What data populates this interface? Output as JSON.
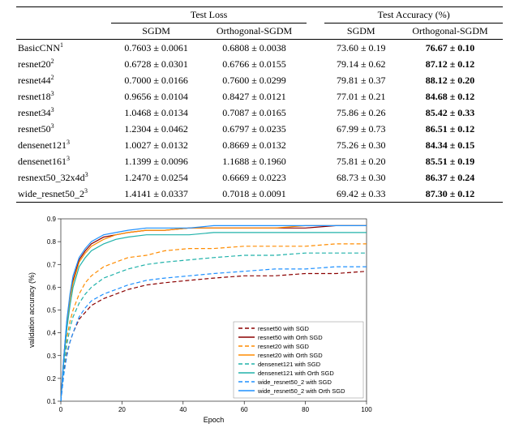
{
  "table": {
    "group_headers": [
      "Test Loss",
      "Test Accuracy (%)"
    ],
    "col_headers": [
      "SGDM",
      "Orthogonal-SGDM",
      "SGDM",
      "Orthogonal-SGDM"
    ],
    "rows": [
      {
        "model": "BasicCNN",
        "sup": "1",
        "loss_sgdm": "0.7603 ± 0.0061",
        "loss_orth": "0.6808 ± 0.0038",
        "acc_sgdm": "73.60 ± 0.19",
        "acc_orth": "76.67 ± 0.10",
        "bold": "orth"
      },
      {
        "model": "resnet20",
        "sup": "2",
        "loss_sgdm": "0.6728 ± 0.0301",
        "loss_orth": "0.6766 ± 0.0155",
        "acc_sgdm": "79.14 ± 0.62",
        "acc_orth": "87.12 ± 0.12",
        "bold": "orth"
      },
      {
        "model": "resnet44",
        "sup": "2",
        "loss_sgdm": "0.7000 ± 0.0166",
        "loss_orth": "0.7600 ± 0.0299",
        "acc_sgdm": "79.81 ± 0.37",
        "acc_orth": "88.12 ± 0.20",
        "bold": "orth"
      },
      {
        "model": "resnet18",
        "sup": "3",
        "loss_sgdm": "0.9656 ± 0.0104",
        "loss_orth": "0.8427 ± 0.0121",
        "acc_sgdm": "77.01 ± 0.21",
        "acc_orth": "84.68 ± 0.12",
        "bold": "orth"
      },
      {
        "model": "resnet34",
        "sup": "3",
        "loss_sgdm": "1.0468 ± 0.0134",
        "loss_orth": "0.7087 ± 0.0165",
        "acc_sgdm": "75.86 ± 0.26",
        "acc_orth": "85.42 ± 0.33",
        "bold": "orth"
      },
      {
        "model": "resnet50",
        "sup": "3",
        "loss_sgdm": "1.2304 ± 0.0462",
        "loss_orth": "0.6797 ± 0.0235",
        "acc_sgdm": "67.99 ± 0.73",
        "acc_orth": "86.51 ± 0.12",
        "bold": "orth"
      },
      {
        "model": "densenet121",
        "sup": "3",
        "loss_sgdm": "1.0027 ± 0.0132",
        "loss_orth": "0.8669 ± 0.0132",
        "acc_sgdm": "75.26 ± 0.30",
        "acc_orth": "84.34 ± 0.15",
        "bold": "orth"
      },
      {
        "model": "densenet161",
        "sup": "3",
        "loss_sgdm": "1.1399 ± 0.0096",
        "loss_orth": "1.1688 ± 0.1960",
        "acc_sgdm": "75.81 ± 0.20",
        "acc_orth": "85.51 ± 0.19",
        "bold": "orth"
      },
      {
        "model": "resnext50_32x4d",
        "sup": "3",
        "loss_sgdm": "1.2470 ± 0.0254",
        "loss_orth": "0.6669 ± 0.0223",
        "acc_sgdm": "68.73 ± 0.30",
        "acc_orth": "86.37 ± 0.24",
        "bold": "orth"
      },
      {
        "model": "wide_resnet50_2",
        "sup": "3",
        "loss_sgdm": "1.4141 ± 0.0337",
        "loss_orth": "0.7018 ± 0.0091",
        "acc_sgdm": "69.42 ± 0.33",
        "acc_orth": "87.30 ± 0.12",
        "bold": "orth"
      }
    ]
  },
  "chart_data": {
    "type": "line",
    "xlabel": "Epoch",
    "ylabel": "validation accuracy (%)",
    "xlim": [
      0,
      100
    ],
    "ylim": [
      0.1,
      0.9
    ],
    "xticks": [
      0,
      20,
      40,
      60,
      80,
      100
    ],
    "yticks": [
      0.1,
      0.2,
      0.3,
      0.4,
      0.5,
      0.6,
      0.7,
      0.8,
      0.9
    ],
    "legend_position": "right",
    "series": [
      {
        "name": "resnet50 with SGD",
        "color": "#8B0000",
        "dash": "5,3",
        "x": [
          0,
          1,
          2,
          3,
          4,
          6,
          8,
          10,
          14,
          18,
          22,
          28,
          34,
          42,
          50,
          60,
          70,
          80,
          90,
          100
        ],
        "y": [
          0.1,
          0.23,
          0.31,
          0.36,
          0.4,
          0.46,
          0.49,
          0.52,
          0.55,
          0.57,
          0.59,
          0.61,
          0.62,
          0.63,
          0.64,
          0.65,
          0.65,
          0.66,
          0.66,
          0.67
        ]
      },
      {
        "name": "resnet50 with Orth SGD",
        "color": "#8B0000",
        "dash": "",
        "x": [
          0,
          1,
          2,
          3,
          4,
          6,
          8,
          10,
          14,
          18,
          22,
          28,
          34,
          42,
          50,
          60,
          70,
          80,
          90,
          100
        ],
        "y": [
          0.1,
          0.3,
          0.45,
          0.56,
          0.63,
          0.72,
          0.76,
          0.79,
          0.82,
          0.83,
          0.84,
          0.85,
          0.85,
          0.86,
          0.86,
          0.86,
          0.86,
          0.86,
          0.87,
          0.87
        ]
      },
      {
        "name": "resnet20 with SGD",
        "color": "#FF8C00",
        "dash": "5,3",
        "x": [
          0,
          1,
          2,
          3,
          4,
          6,
          8,
          10,
          14,
          18,
          22,
          28,
          34,
          42,
          50,
          60,
          70,
          80,
          90,
          100
        ],
        "y": [
          0.1,
          0.28,
          0.38,
          0.45,
          0.5,
          0.57,
          0.62,
          0.65,
          0.69,
          0.71,
          0.73,
          0.74,
          0.76,
          0.77,
          0.77,
          0.78,
          0.78,
          0.78,
          0.79,
          0.79
        ]
      },
      {
        "name": "resnet20 with Orth SGD",
        "color": "#FF8C00",
        "dash": "",
        "x": [
          0,
          1,
          2,
          3,
          4,
          6,
          8,
          10,
          14,
          18,
          22,
          28,
          34,
          42,
          50,
          60,
          70,
          80,
          90,
          100
        ],
        "y": [
          0.1,
          0.3,
          0.44,
          0.55,
          0.62,
          0.71,
          0.75,
          0.78,
          0.81,
          0.83,
          0.84,
          0.85,
          0.85,
          0.86,
          0.86,
          0.86,
          0.86,
          0.87,
          0.87,
          0.87
        ]
      },
      {
        "name": "densenet121 with SGD",
        "color": "#20B2AA",
        "dash": "5,3",
        "x": [
          0,
          1,
          2,
          3,
          4,
          6,
          8,
          10,
          14,
          18,
          22,
          28,
          34,
          42,
          50,
          60,
          70,
          80,
          90,
          100
        ],
        "y": [
          0.1,
          0.26,
          0.35,
          0.42,
          0.47,
          0.53,
          0.57,
          0.6,
          0.64,
          0.66,
          0.68,
          0.7,
          0.71,
          0.72,
          0.73,
          0.74,
          0.74,
          0.75,
          0.75,
          0.75
        ]
      },
      {
        "name": "densenet121 with Orth SGD",
        "color": "#20B2AA",
        "dash": "",
        "x": [
          0,
          1,
          2,
          3,
          4,
          6,
          8,
          10,
          14,
          18,
          22,
          28,
          34,
          42,
          50,
          60,
          70,
          80,
          90,
          100
        ],
        "y": [
          0.1,
          0.28,
          0.42,
          0.52,
          0.6,
          0.69,
          0.73,
          0.76,
          0.79,
          0.81,
          0.82,
          0.83,
          0.83,
          0.83,
          0.84,
          0.84,
          0.84,
          0.84,
          0.84,
          0.84
        ]
      },
      {
        "name": "wide_resnet50_2 with SGD",
        "color": "#1E90FF",
        "dash": "5,3",
        "x": [
          0,
          1,
          2,
          3,
          4,
          6,
          8,
          10,
          14,
          18,
          22,
          28,
          34,
          42,
          50,
          60,
          70,
          80,
          90,
          100
        ],
        "y": [
          0.1,
          0.22,
          0.3,
          0.36,
          0.4,
          0.47,
          0.51,
          0.54,
          0.57,
          0.59,
          0.61,
          0.63,
          0.64,
          0.65,
          0.66,
          0.67,
          0.68,
          0.68,
          0.69,
          0.69
        ]
      },
      {
        "name": "wide_resnet50_2 with Orth SGD",
        "color": "#1E90FF",
        "dash": "",
        "x": [
          0,
          1,
          2,
          3,
          4,
          6,
          8,
          10,
          14,
          18,
          22,
          28,
          34,
          42,
          50,
          60,
          70,
          80,
          90,
          100
        ],
        "y": [
          0.1,
          0.3,
          0.46,
          0.57,
          0.65,
          0.73,
          0.77,
          0.8,
          0.83,
          0.84,
          0.85,
          0.86,
          0.86,
          0.86,
          0.87,
          0.87,
          0.87,
          0.87,
          0.87,
          0.87
        ]
      }
    ]
  }
}
